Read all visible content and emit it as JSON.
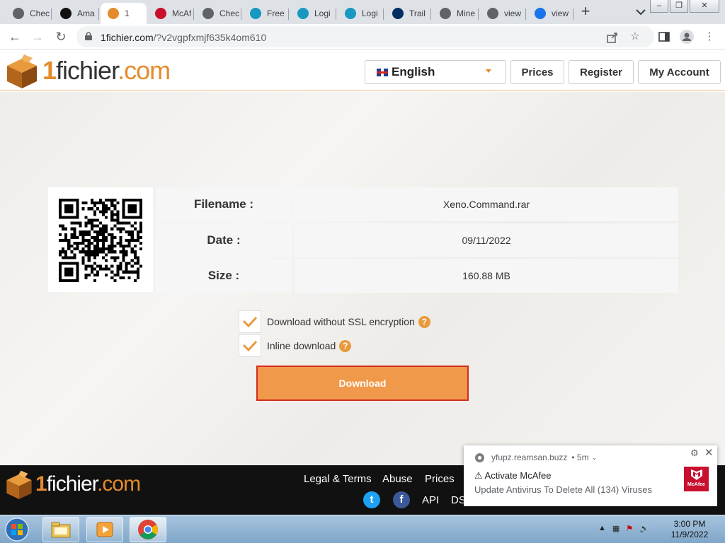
{
  "browser": {
    "tabs": [
      {
        "label": "Chec",
        "icon": "globe-icon",
        "color": "#5f6368"
      },
      {
        "label": "Ama",
        "icon": "amazon-icon",
        "color": "#111111"
      },
      {
        "label": "1",
        "icon": "1fichier-icon",
        "color": "#e48b2c",
        "active": true
      },
      {
        "label": "McAf",
        "icon": "mcafee-icon",
        "color": "#c8102e"
      },
      {
        "label": "Chec",
        "icon": "globe-icon",
        "color": "#5f6368"
      },
      {
        "label": "Free",
        "icon": "salesforce-icon",
        "color": "#1798c1"
      },
      {
        "label": "Logi",
        "icon": "salesforce-icon",
        "color": "#1798c1"
      },
      {
        "label": "Logi",
        "icon": "salesforce-icon",
        "color": "#1798c1"
      },
      {
        "label": "Trail",
        "icon": "trailhead-icon",
        "color": "#032d60"
      },
      {
        "label": "Mine",
        "icon": "globe-icon",
        "color": "#5f6368"
      },
      {
        "label": "view",
        "icon": "globe-icon",
        "color": "#5f6368"
      },
      {
        "label": "view",
        "icon": "download-icon",
        "color": "#1a73e8"
      }
    ],
    "new_tab_symbol": "+",
    "url_host": "1fichier.com",
    "url_path": "/?v2vgpfxmjf635k4om610"
  },
  "site": {
    "logo_num": "1",
    "logo_name": "fichier",
    "logo_dom": ".com",
    "language": "English",
    "nav": {
      "prices": "Prices",
      "register": "Register",
      "account": "My Account"
    }
  },
  "file": {
    "labels": {
      "filename": "Filename :",
      "date": "Date :",
      "size": "Size :"
    },
    "filename": "Xeno.Command.rar",
    "date": "09/11/2022",
    "size": "160.88 MB"
  },
  "options": {
    "no_ssl": {
      "label": "Download without SSL encryption",
      "checked": true
    },
    "inline": {
      "label": "Inline download",
      "checked": true
    },
    "help_symbol": "?"
  },
  "download_label": "Download",
  "footer": {
    "links": {
      "legal": "Legal & Terms",
      "abuse": "Abuse",
      "prices": "Prices",
      "api": "API",
      "dsa": "DS"
    },
    "twitter_symbol": "t",
    "facebook_symbol": "f"
  },
  "notification": {
    "source": "yfupz.reamsan.buzz",
    "age": "• 5m",
    "title": "⚠ Activate McAfee",
    "body": "Update Antivirus To Delete All (134) Viruses",
    "badge_text": "McAfee"
  },
  "taskbar": {
    "time": "3:00 PM",
    "date": "11/9/2022"
  },
  "colors": {
    "accent": "#e48b2c",
    "download_fill": "#f0994a",
    "download_border": "#d62b1f"
  }
}
